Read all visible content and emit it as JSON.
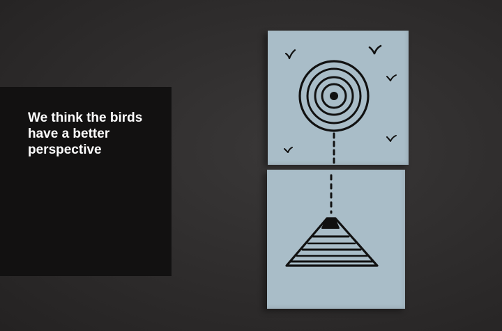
{
  "photo": {
    "caption_lines": [
      "We think the birds",
      "have a better",
      "perspective"
    ],
    "colors": {
      "wall": "#2e2c2c",
      "caption_panel": "#121111",
      "caption_text": "#ffffff",
      "sticky_note": "#a9bdc8",
      "ink": "#111111"
    },
    "icons": [
      "bird-icon",
      "target-icon",
      "pyramid-icon"
    ]
  }
}
